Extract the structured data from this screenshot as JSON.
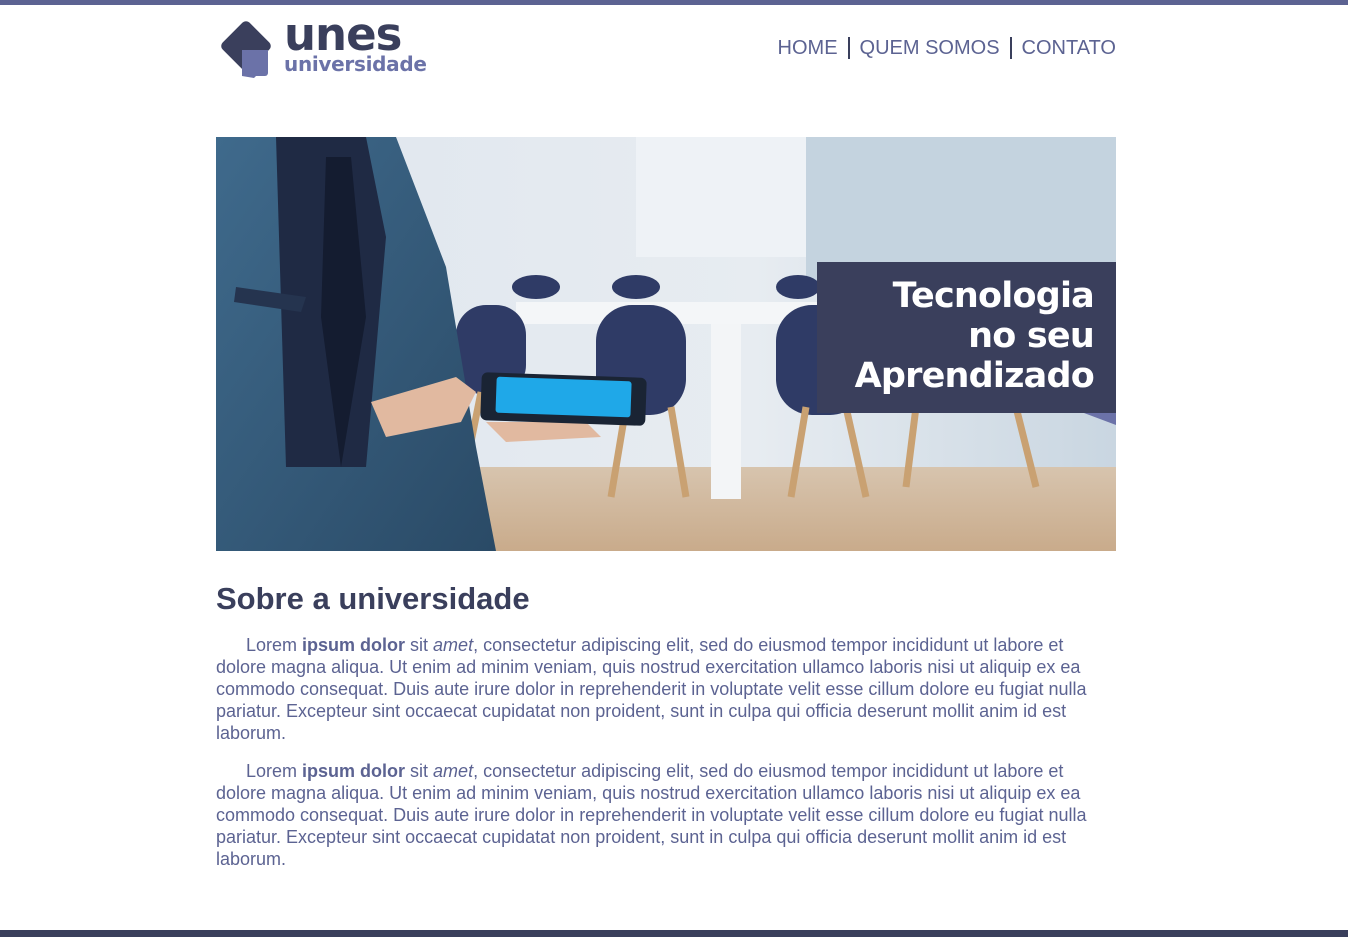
{
  "brand": {
    "name": "unes",
    "subtitle": "universidade",
    "colors": {
      "primary": "#3a3f5c",
      "accent": "#6b72a8",
      "text": "#5c6392"
    }
  },
  "nav": {
    "items": [
      {
        "label": "HOME"
      },
      {
        "label": "QUEM SOMOS"
      },
      {
        "label": "CONTATO"
      }
    ]
  },
  "banner": {
    "caption_lines": [
      "Tecnologia",
      "no seu",
      "Aprendizado"
    ],
    "image": "person-holding-tablet-in-meeting-room"
  },
  "about": {
    "title": "Sobre a universidade",
    "paragraphs": [
      {
        "lead": "Lorem ",
        "bold": "ipsum dolor",
        "mid": " sit ",
        "italic": "amet",
        "rest": ", consectetur adipiscing elit, sed do eiusmod tempor incididunt ut labore et dolore magna aliqua. Ut enim ad minim veniam, quis nostrud exercitation ullamco laboris nisi ut aliquip ex ea commodo consequat. Duis aute irure dolor in reprehenderit in voluptate velit esse cillum dolore eu fugiat nulla pariatur. Excepteur sint occaecat cupidatat non proident, sunt in culpa qui officia deserunt mollit anim id est laborum."
      },
      {
        "lead": "Lorem ",
        "bold": "ipsum dolor",
        "mid": " sit ",
        "italic": "amet",
        "rest": ", consectetur adipiscing elit, sed do eiusmod tempor incididunt ut labore et dolore magna aliqua. Ut enim ad minim veniam, quis nostrud exercitation ullamco laboris nisi ut aliquip ex ea commodo consequat. Duis aute irure dolor in reprehenderit in voluptate velit esse cillum dolore eu fugiat nulla pariatur. Excepteur sint occaecat cupidatat non proident, sunt in culpa qui officia deserunt mollit anim id est laborum."
      }
    ]
  }
}
